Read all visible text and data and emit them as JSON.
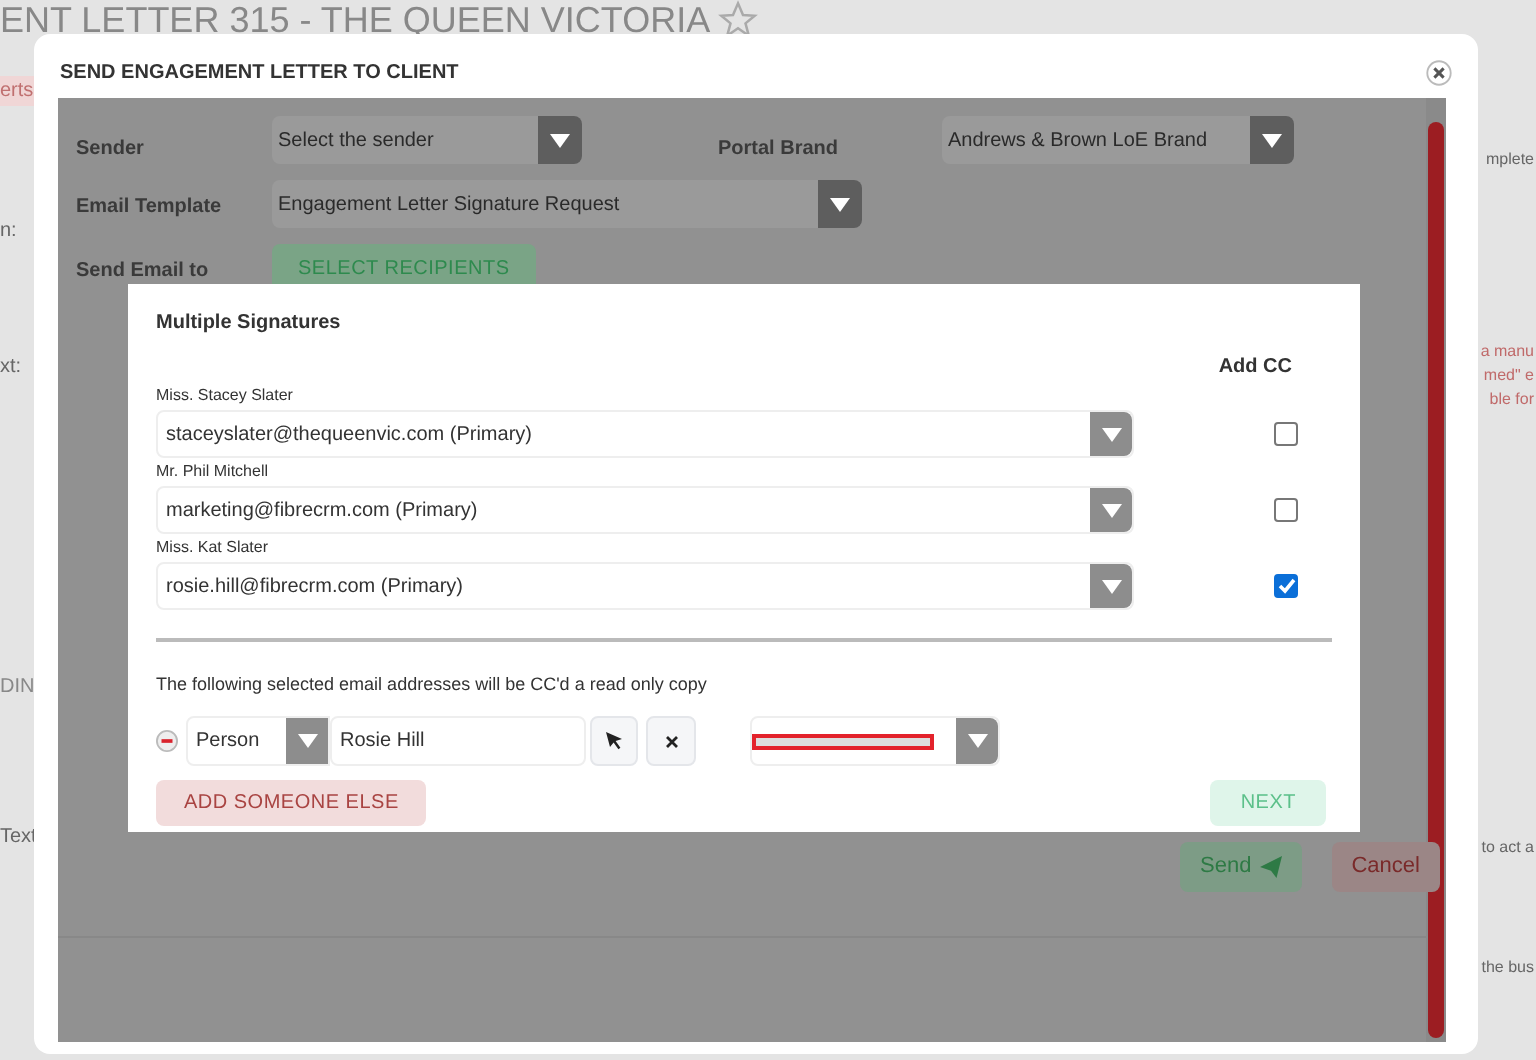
{
  "page_title": "ENT LETTER 315 - THE QUEEN VICTORIA",
  "page_fragments_left": [
    "erts",
    "n:",
    "xt:",
    "DIN",
    "Text"
  ],
  "page_fragments_right": [
    "mplete",
    "a manu",
    "med\" e",
    "ble for",
    "to act a",
    "the bus"
  ],
  "modal": {
    "title": "SEND ENGAGEMENT LETTER TO CLIENT",
    "form": {
      "sender": {
        "label": "Sender",
        "value": "Select the sender"
      },
      "portal_brand": {
        "label": "Portal Brand",
        "value": "Andrews & Brown LoE Brand"
      },
      "email_template": {
        "label": "Email Template",
        "value": "Engagement Letter Signature Request"
      },
      "send_email_to": {
        "label": "Send Email to",
        "button": "SELECT RECIPIENTS"
      },
      "buttons": [
        {
          "label": "Send",
          "kind": "send"
        },
        {
          "label": "Cancel",
          "kind": "cancel"
        }
      ]
    },
    "dialog": {
      "title": "Multiple Signatures",
      "cc_heading": "Add CC",
      "signers": [
        {
          "name": "Miss. Stacey Slater",
          "email": "staceyslater@thequeenvic.com (Primary)",
          "cc": false
        },
        {
          "name": "Mr. Phil Mitchell",
          "email": "marketing@fibrecrm.com (Primary)",
          "cc": false
        },
        {
          "name": "Miss. Kat Slater",
          "email": "rosie.hill@fibrecrm.com (Primary)",
          "cc": true
        }
      ],
      "cc_note": "The following selected email addresses will be CC'd a read only copy",
      "cc_row": {
        "type": "Person",
        "name": "Rosie Hill"
      },
      "add_button": "ADD SOMEONE ELSE",
      "next_button": "NEXT"
    }
  }
}
